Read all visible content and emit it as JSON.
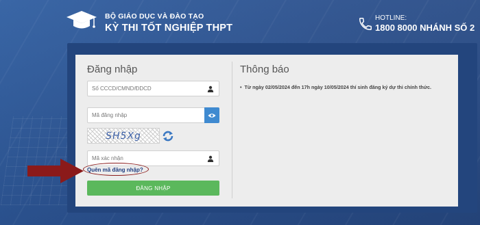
{
  "header": {
    "ministry": "BỘ GIÁO DỤC VÀ ĐÀO TẠO",
    "exam_name": "KỲ THI TỐT NGHIỆP THPT",
    "hotline_label": "HOTLINE:",
    "hotline_number": "1800 8000 NHÁNH SỐ 2"
  },
  "login": {
    "title": "Đăng nhập",
    "id_placeholder": "Số CCCD/CMND/ĐDCD",
    "password_placeholder": "Mã đăng nhập",
    "captcha_text": "SH5Xg",
    "captcha_placeholder": "Mã xác nhận",
    "forgot_link": "Quên mã đăng nhập?",
    "submit_label": "ĐĂNG NHẬP"
  },
  "notice": {
    "title": "Thông báo",
    "items": [
      "Từ ngày 02/05/2024 đến 17h ngày 10/05/2024 thí sinh đăng ký dự thi chính thức."
    ]
  },
  "colors": {
    "background": "#2f5ea1",
    "panel_frame": "#23457d",
    "panel": "#ededed",
    "login_button": "#5bb85c",
    "eye_button": "#3f8ad0",
    "annotation": "#8b1a1a"
  },
  "icons": {
    "logo": "graduation-cap-icon",
    "hotline": "phone-icon",
    "id_field": "user-icon",
    "password_toggle": "eye-icon",
    "captcha_field": "user-icon",
    "captcha_refresh": "refresh-icon",
    "annotation": "arrow-right-icon"
  }
}
